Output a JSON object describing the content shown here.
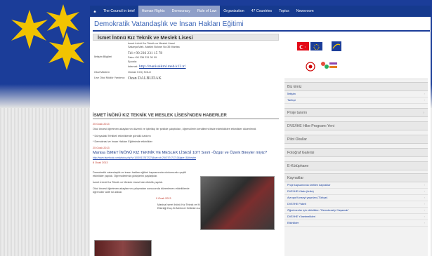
{
  "nav": {
    "items": [
      "The Council in brief",
      "Human Rights",
      "Democracy",
      "Rule of Law",
      "Organization",
      "47 Countries",
      "Topics",
      "Newsroom"
    ]
  },
  "site": {
    "title": "Demokratik Vatandaşlık ve İnsan Hakları Eğitimi"
  },
  "school": {
    "name": "İsmet İnönü Kız Teknik ve Meslek Lisesi",
    "address_lbl": "İletişim Bilgileri",
    "address1": "İsmet İnönü Kız Teknik ve Meslek Lisesi",
    "address2": "Sakarya Mah. Atatürk Bulvarı No:35 Manisa",
    "tel": "Tel:+90 236 231 15 78",
    "fax": "Faks:+90 236 231 30 09",
    "eposta": "Eposta:",
    "internet": "İnternet:",
    "url": "http://manisaikml.meb.k12.tr/",
    "okul_mudur_lbl": "Okul Müdürü",
    "okul_mudur": "Osman KOÇ KOLU",
    "lise_mudur_lbl": "Lise Okul Müdür Yardımcı",
    "lise_mudur": "Ozan DALBUDAK"
  },
  "news": {
    "heading": "İSMET İNÖNÜ KIZ TEKNİK VE MESLEK LİSESİ'NDEN HABERLER",
    "items": [
      {
        "date": "25 Ocak 2013",
        "text": "Okul öncesi öğretmen adaylarının düzenli ve işbirlikçi bir şekilde çalıştıkları, öğrencilerin kendilerini ifade edebildikleri etkinlikler düzenlendi."
      },
      {
        "date": "",
        "text": "* Dünyadaki Tehlikeli etkinliklerde gönüllü katılımı"
      },
      {
        "date": "",
        "text": "* Demokrasi ve İnsan Hakları Eğitiminde etkinlikler"
      },
      {
        "date": "25 Ocak 2013",
        "title": "Manisa İSMET İNÖNÜ KIZ TEKNİK VE MESLEK LİSESİ 10/T Sınıfı -Özgür ve Özerk Bireyler miyiz?",
        "link": "http://www.facebook.com/photo.php?v=10000137672276&set=vb.254747471710&type=3&theater"
      },
      {
        "date": "8 Ocak 2013",
        "text": "Demokratik vatandaşlık ve insan hakları eğitimi kapsamında okulumuzda çeşitli etkinlikler yapıldı. Öğrencilerimiz görüşlerini paylaştılar."
      },
      {
        "date": "",
        "text": "İsmet İnönü Kız Teknik ve Meslek Lisesi'nde etkinlik yapıldı."
      },
      {
        "date": "",
        "text": "Okul öncesi öğretmen adaylarının çalışmaları sonucunda düzenlenen etkinliklerde öğrenciler aktif rol aldılar."
      },
      {
        "date": "9 Ocak 2013",
        "text": ""
      },
      {
        "date": "",
        "text": "Manisa İsmet İnönü Kız Teknik ve Meslek Lisesi'nde DVİHE Etkinliği Doç.Dr.Mehmet Gültekin konferans verdi."
      }
    ]
  },
  "sidebar": {
    "biz_kimiz": "Biz kimiz",
    "links1": [
      "İletişim",
      "Tarihçe"
    ],
    "headers": [
      "Proje tanımı",
      "DVE/İHE Hibe Programı Yeni",
      "Pilot Okullar",
      "Fotoğraf Galerisi",
      "E-Kütüphane"
    ],
    "kaynaklar": "Kaynaklar",
    "kaynak_links": [
      "Proje kapsamında üretilen kaynaklar",
      "DVE/İHE Kitabı (ünite)",
      "Avrupa Konseyi yayınları (Türkçe)",
      "DVE/İHE Paketi",
      "Öğretmenler için etkinlikler: \"Demokrasi'yi Yaşamak\"",
      "DVE/İHE Yönetmelikleri",
      "Etkinlikler"
    ]
  },
  "colors": {
    "banner": "#1b3d99",
    "star": "#f2c300",
    "accent": "#3a64b6",
    "date": "#c0392b"
  }
}
